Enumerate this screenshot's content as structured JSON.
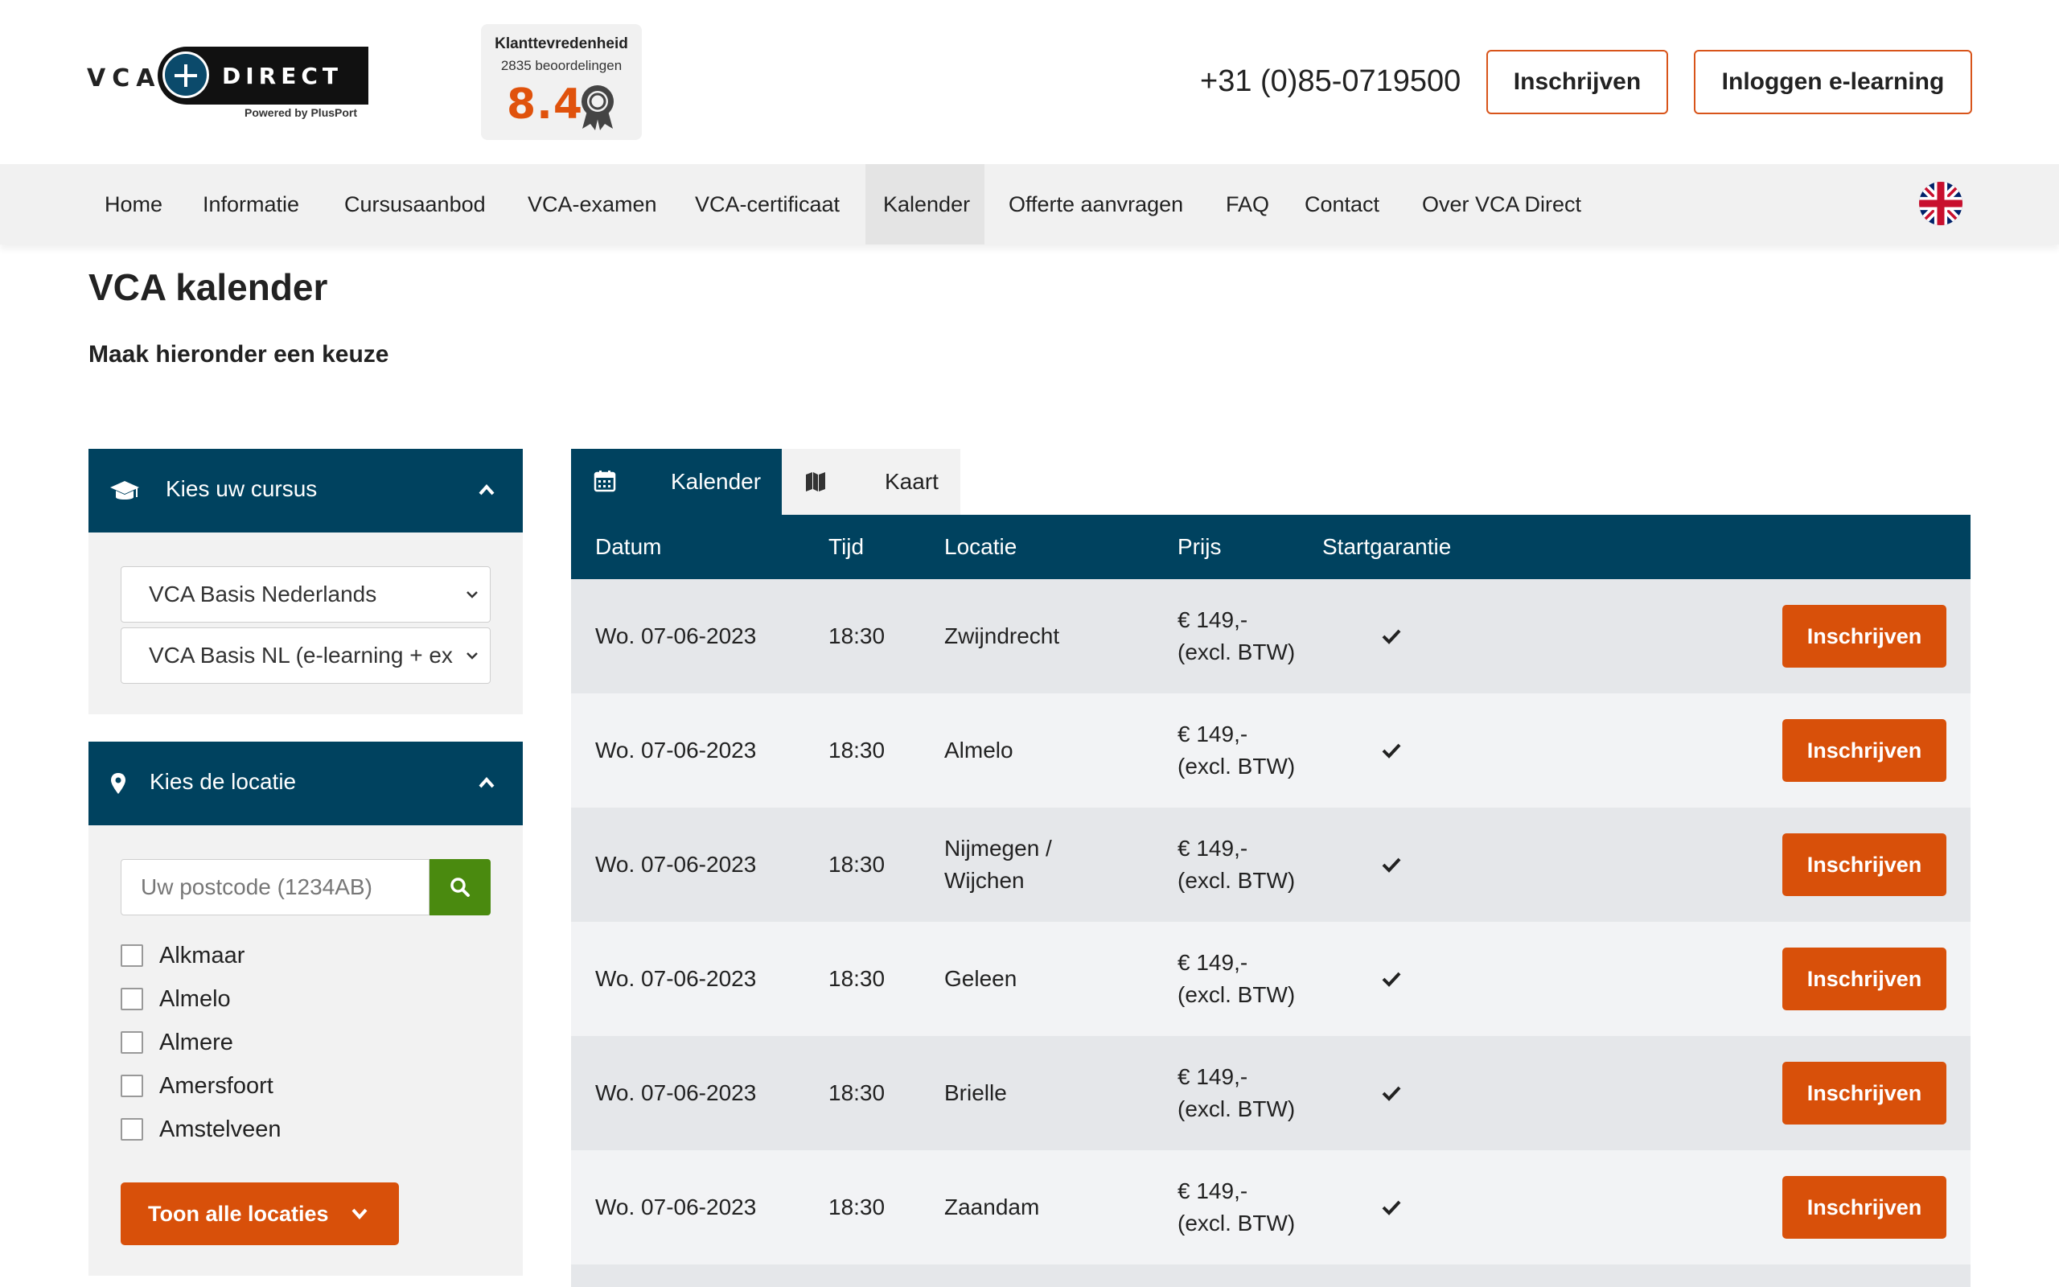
{
  "header": {
    "logo": {
      "left": "VCA",
      "right": "DIRECT",
      "tagline": "Powered by PlusPort"
    },
    "rating": {
      "title": "Klanttevredenheid",
      "count": "2835 beoordelingen",
      "score": "8.4"
    },
    "phone": "+31 (0)85-0719500",
    "register_label": "Inschrijven",
    "login_label": "Inloggen e-learning"
  },
  "nav": {
    "items": [
      "Home",
      "Informatie",
      "Cursusaanbod",
      "VCA-examen",
      "VCA-certificaat",
      "Kalender",
      "Offerte aanvragen",
      "FAQ",
      "Contact",
      "Over VCA Direct"
    ],
    "active": "Kalender",
    "language_flag": "uk-flag-icon"
  },
  "page": {
    "title": "VCA kalender",
    "subtitle": "Maak hieronder een keuze"
  },
  "sidebar": {
    "course": {
      "title": "Kies uw cursus",
      "select1": "VCA Basis Nederlands",
      "select2": "VCA Basis NL (e-learning + ex"
    },
    "location": {
      "title": "Kies de locatie",
      "postcode_placeholder": "Uw postcode (1234AB)",
      "options": [
        "Alkmaar",
        "Almelo",
        "Almere",
        "Amersfoort",
        "Amstelveen"
      ],
      "show_all_label": "Toon alle locaties"
    }
  },
  "tabs": {
    "calendar": "Kalender",
    "map": "Kaart"
  },
  "table": {
    "headers": {
      "date": "Datum",
      "time": "Tijd",
      "location": "Locatie",
      "price": "Prijs",
      "guarantee": "Startgarantie"
    },
    "rows": [
      {
        "date": "Wo. 07-06-2023",
        "time": "18:30",
        "location": "Zwijndrecht",
        "price_line1": "€ 149,-",
        "price_line2": "(excl. BTW)",
        "guarantee": true,
        "button": "Inschrijven"
      },
      {
        "date": "Wo. 07-06-2023",
        "time": "18:30",
        "location": "Almelo",
        "price_line1": "€ 149,-",
        "price_line2": "(excl. BTW)",
        "guarantee": true,
        "button": "Inschrijven"
      },
      {
        "date": "Wo. 07-06-2023",
        "time": "18:30",
        "location": "Nijmegen / Wijchen",
        "price_line1": "€ 149,-",
        "price_line2": "(excl. BTW)",
        "guarantee": true,
        "button": "Inschrijven"
      },
      {
        "date": "Wo. 07-06-2023",
        "time": "18:30",
        "location": "Geleen",
        "price_line1": "€ 149,-",
        "price_line2": "(excl. BTW)",
        "guarantee": true,
        "button": "Inschrijven"
      },
      {
        "date": "Wo. 07-06-2023",
        "time": "18:30",
        "location": "Brielle",
        "price_line1": "€ 149,-",
        "price_line2": "(excl. BTW)",
        "guarantee": true,
        "button": "Inschrijven"
      },
      {
        "date": "Wo. 07-06-2023",
        "time": "18:30",
        "location": "Zaandam",
        "price_line1": "€ 149,-",
        "price_line2": "(excl. BTW)",
        "guarantee": true,
        "button": "Inschrijven"
      }
    ]
  },
  "colors": {
    "primary": "#00425f",
    "accent": "#d8500a",
    "search": "#4a8a0f",
    "score": "#e0520c"
  }
}
